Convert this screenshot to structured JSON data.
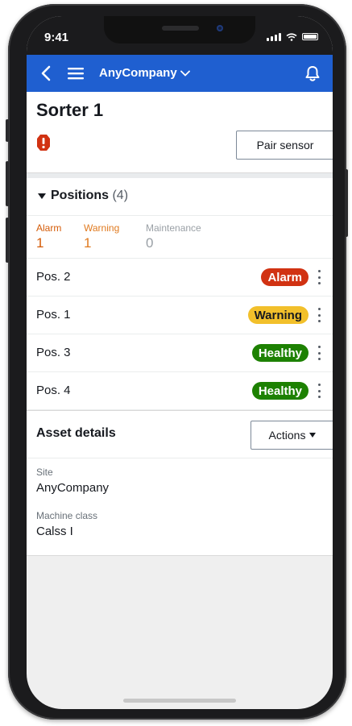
{
  "status_bar": {
    "time": "9:41"
  },
  "nav": {
    "company": "AnyCompany"
  },
  "header": {
    "title": "Sorter 1",
    "pair_button": "Pair sensor"
  },
  "positions": {
    "label": "Positions",
    "count": "(4)",
    "counters": [
      {
        "label": "Alarm",
        "value": "1",
        "color": "#d45b07"
      },
      {
        "label": "Warning",
        "value": "1",
        "color": "#e07a1f"
      },
      {
        "label": "Maintenance",
        "value": "0",
        "color": "#9aa0a6"
      }
    ],
    "rows": [
      {
        "name": "Pos. 2",
        "status": "Alarm",
        "color": "#d13212",
        "text_color": "#ffffff"
      },
      {
        "name": "Pos. 1",
        "status": "Warning",
        "color": "#f2c02b",
        "text_color": "#16191f"
      },
      {
        "name": "Pos. 3",
        "status": "Healthy",
        "color": "#1d8102",
        "text_color": "#ffffff"
      },
      {
        "name": "Pos. 4",
        "status": "Healthy",
        "color": "#1d8102",
        "text_color": "#ffffff"
      }
    ]
  },
  "asset": {
    "label": "Asset details",
    "actions_button": "Actions",
    "fields": [
      {
        "key": "Site",
        "value": "AnyCompany"
      },
      {
        "key": "Machine class",
        "value": "Calss I"
      }
    ]
  },
  "colors": {
    "nav_blue": "#1f5fd0",
    "alert_red": "#d13212"
  }
}
